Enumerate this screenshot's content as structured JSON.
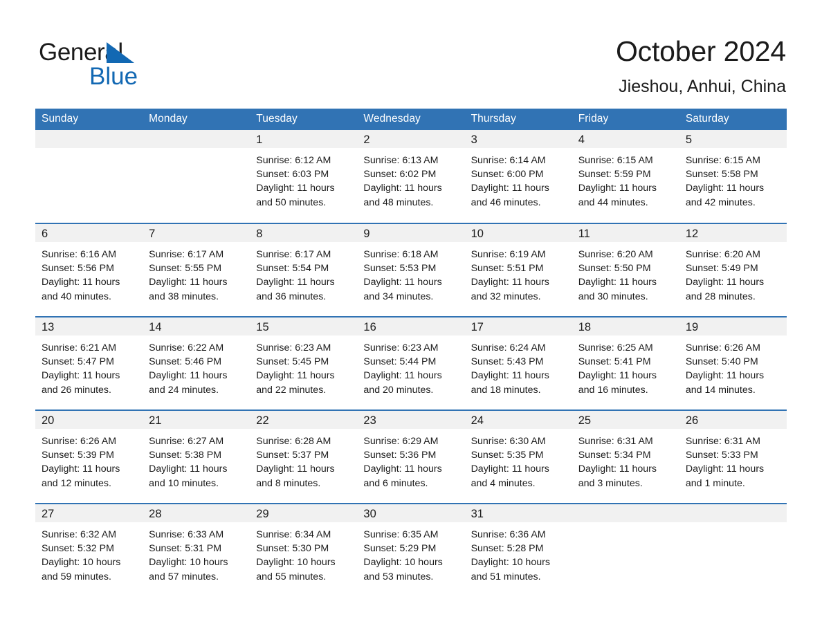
{
  "brand": {
    "name_part1": "General",
    "name_part2": "Blue",
    "logo_icon": "triangle-icon",
    "accent_color": "#1268b3",
    "header_color": "#3173b4"
  },
  "header": {
    "title": "October 2024",
    "subtitle": "Jieshou, Anhui, China"
  },
  "weekdays": [
    "Sunday",
    "Monday",
    "Tuesday",
    "Wednesday",
    "Thursday",
    "Friday",
    "Saturday"
  ],
  "weeks": [
    [
      {
        "day": "",
        "sunrise": "",
        "sunset": "",
        "daylight_line1": "",
        "daylight_line2": "",
        "empty": true
      },
      {
        "day": "",
        "sunrise": "",
        "sunset": "",
        "daylight_line1": "",
        "daylight_line2": "",
        "empty": true
      },
      {
        "day": "1",
        "sunrise": "Sunrise: 6:12 AM",
        "sunset": "Sunset: 6:03 PM",
        "daylight_line1": "Daylight: 11 hours",
        "daylight_line2": "and 50 minutes."
      },
      {
        "day": "2",
        "sunrise": "Sunrise: 6:13 AM",
        "sunset": "Sunset: 6:02 PM",
        "daylight_line1": "Daylight: 11 hours",
        "daylight_line2": "and 48 minutes."
      },
      {
        "day": "3",
        "sunrise": "Sunrise: 6:14 AM",
        "sunset": "Sunset: 6:00 PM",
        "daylight_line1": "Daylight: 11 hours",
        "daylight_line2": "and 46 minutes."
      },
      {
        "day": "4",
        "sunrise": "Sunrise: 6:15 AM",
        "sunset": "Sunset: 5:59 PM",
        "daylight_line1": "Daylight: 11 hours",
        "daylight_line2": "and 44 minutes."
      },
      {
        "day": "5",
        "sunrise": "Sunrise: 6:15 AM",
        "sunset": "Sunset: 5:58 PM",
        "daylight_line1": "Daylight: 11 hours",
        "daylight_line2": "and 42 minutes."
      }
    ],
    [
      {
        "day": "6",
        "sunrise": "Sunrise: 6:16 AM",
        "sunset": "Sunset: 5:56 PM",
        "daylight_line1": "Daylight: 11 hours",
        "daylight_line2": "and 40 minutes."
      },
      {
        "day": "7",
        "sunrise": "Sunrise: 6:17 AM",
        "sunset": "Sunset: 5:55 PM",
        "daylight_line1": "Daylight: 11 hours",
        "daylight_line2": "and 38 minutes."
      },
      {
        "day": "8",
        "sunrise": "Sunrise: 6:17 AM",
        "sunset": "Sunset: 5:54 PM",
        "daylight_line1": "Daylight: 11 hours",
        "daylight_line2": "and 36 minutes."
      },
      {
        "day": "9",
        "sunrise": "Sunrise: 6:18 AM",
        "sunset": "Sunset: 5:53 PM",
        "daylight_line1": "Daylight: 11 hours",
        "daylight_line2": "and 34 minutes."
      },
      {
        "day": "10",
        "sunrise": "Sunrise: 6:19 AM",
        "sunset": "Sunset: 5:51 PM",
        "daylight_line1": "Daylight: 11 hours",
        "daylight_line2": "and 32 minutes."
      },
      {
        "day": "11",
        "sunrise": "Sunrise: 6:20 AM",
        "sunset": "Sunset: 5:50 PM",
        "daylight_line1": "Daylight: 11 hours",
        "daylight_line2": "and 30 minutes."
      },
      {
        "day": "12",
        "sunrise": "Sunrise: 6:20 AM",
        "sunset": "Sunset: 5:49 PM",
        "daylight_line1": "Daylight: 11 hours",
        "daylight_line2": "and 28 minutes."
      }
    ],
    [
      {
        "day": "13",
        "sunrise": "Sunrise: 6:21 AM",
        "sunset": "Sunset: 5:47 PM",
        "daylight_line1": "Daylight: 11 hours",
        "daylight_line2": "and 26 minutes."
      },
      {
        "day": "14",
        "sunrise": "Sunrise: 6:22 AM",
        "sunset": "Sunset: 5:46 PM",
        "daylight_line1": "Daylight: 11 hours",
        "daylight_line2": "and 24 minutes."
      },
      {
        "day": "15",
        "sunrise": "Sunrise: 6:23 AM",
        "sunset": "Sunset: 5:45 PM",
        "daylight_line1": "Daylight: 11 hours",
        "daylight_line2": "and 22 minutes."
      },
      {
        "day": "16",
        "sunrise": "Sunrise: 6:23 AM",
        "sunset": "Sunset: 5:44 PM",
        "daylight_line1": "Daylight: 11 hours",
        "daylight_line2": "and 20 minutes."
      },
      {
        "day": "17",
        "sunrise": "Sunrise: 6:24 AM",
        "sunset": "Sunset: 5:43 PM",
        "daylight_line1": "Daylight: 11 hours",
        "daylight_line2": "and 18 minutes."
      },
      {
        "day": "18",
        "sunrise": "Sunrise: 6:25 AM",
        "sunset": "Sunset: 5:41 PM",
        "daylight_line1": "Daylight: 11 hours",
        "daylight_line2": "and 16 minutes."
      },
      {
        "day": "19",
        "sunrise": "Sunrise: 6:26 AM",
        "sunset": "Sunset: 5:40 PM",
        "daylight_line1": "Daylight: 11 hours",
        "daylight_line2": "and 14 minutes."
      }
    ],
    [
      {
        "day": "20",
        "sunrise": "Sunrise: 6:26 AM",
        "sunset": "Sunset: 5:39 PM",
        "daylight_line1": "Daylight: 11 hours",
        "daylight_line2": "and 12 minutes."
      },
      {
        "day": "21",
        "sunrise": "Sunrise: 6:27 AM",
        "sunset": "Sunset: 5:38 PM",
        "daylight_line1": "Daylight: 11 hours",
        "daylight_line2": "and 10 minutes."
      },
      {
        "day": "22",
        "sunrise": "Sunrise: 6:28 AM",
        "sunset": "Sunset: 5:37 PM",
        "daylight_line1": "Daylight: 11 hours",
        "daylight_line2": "and 8 minutes."
      },
      {
        "day": "23",
        "sunrise": "Sunrise: 6:29 AM",
        "sunset": "Sunset: 5:36 PM",
        "daylight_line1": "Daylight: 11 hours",
        "daylight_line2": "and 6 minutes."
      },
      {
        "day": "24",
        "sunrise": "Sunrise: 6:30 AM",
        "sunset": "Sunset: 5:35 PM",
        "daylight_line1": "Daylight: 11 hours",
        "daylight_line2": "and 4 minutes."
      },
      {
        "day": "25",
        "sunrise": "Sunrise: 6:31 AM",
        "sunset": "Sunset: 5:34 PM",
        "daylight_line1": "Daylight: 11 hours",
        "daylight_line2": "and 3 minutes."
      },
      {
        "day": "26",
        "sunrise": "Sunrise: 6:31 AM",
        "sunset": "Sunset: 5:33 PM",
        "daylight_line1": "Daylight: 11 hours",
        "daylight_line2": "and 1 minute."
      }
    ],
    [
      {
        "day": "27",
        "sunrise": "Sunrise: 6:32 AM",
        "sunset": "Sunset: 5:32 PM",
        "daylight_line1": "Daylight: 10 hours",
        "daylight_line2": "and 59 minutes."
      },
      {
        "day": "28",
        "sunrise": "Sunrise: 6:33 AM",
        "sunset": "Sunset: 5:31 PM",
        "daylight_line1": "Daylight: 10 hours",
        "daylight_line2": "and 57 minutes."
      },
      {
        "day": "29",
        "sunrise": "Sunrise: 6:34 AM",
        "sunset": "Sunset: 5:30 PM",
        "daylight_line1": "Daylight: 10 hours",
        "daylight_line2": "and 55 minutes."
      },
      {
        "day": "30",
        "sunrise": "Sunrise: 6:35 AM",
        "sunset": "Sunset: 5:29 PM",
        "daylight_line1": "Daylight: 10 hours",
        "daylight_line2": "and 53 minutes."
      },
      {
        "day": "31",
        "sunrise": "Sunrise: 6:36 AM",
        "sunset": "Sunset: 5:28 PM",
        "daylight_line1": "Daylight: 10 hours",
        "daylight_line2": "and 51 minutes."
      },
      {
        "day": "",
        "sunrise": "",
        "sunset": "",
        "daylight_line1": "",
        "daylight_line2": "",
        "empty": true
      },
      {
        "day": "",
        "sunrise": "",
        "sunset": "",
        "daylight_line1": "",
        "daylight_line2": "",
        "empty": true
      }
    ]
  ]
}
